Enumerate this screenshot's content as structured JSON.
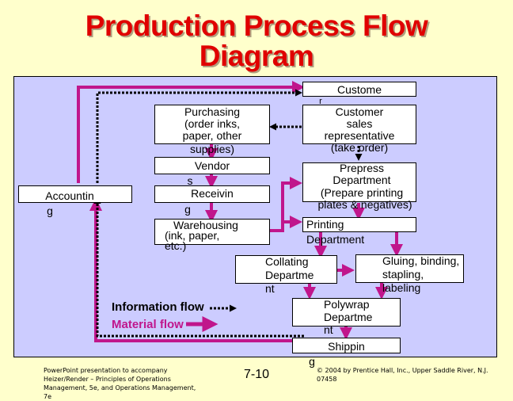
{
  "title": {
    "line1": "Production Process Flow",
    "line2": "Diagram"
  },
  "nodes": {
    "customer": [
      "Custome",
      "r"
    ],
    "customer_sales": [
      "Customer",
      "sales",
      "representative",
      "(take order)"
    ],
    "purchasing": [
      "Purchasing",
      "(order inks,",
      "paper, other",
      "supplies)"
    ],
    "vendors": [
      "Vendor",
      "s"
    ],
    "receiving": [
      "Receivin",
      "g"
    ],
    "accounting": [
      "Accountin",
      "g"
    ],
    "warehousing": [
      "Warehousing",
      "(ink, paper,",
      "etc.)"
    ],
    "prepress": [
      "Prepress",
      "Department",
      "(Prepare printing",
      "plates  & negatives)"
    ],
    "printing": [
      "Printing",
      "Department"
    ],
    "collating": [
      "Collating",
      "Departme",
      "nt"
    ],
    "gluing": [
      "Gluing, binding,",
      "stapling,",
      "labeling"
    ],
    "polywrap": [
      "Polywrap",
      "Departme",
      "nt"
    ],
    "shipping": [
      "Shippin",
      "g"
    ]
  },
  "legend": {
    "information": "Information flow",
    "material": "Material flow"
  },
  "colors": {
    "material": "#c0168c",
    "information": "#000000",
    "title": "#e00000",
    "panel": "#ccccff",
    "background": "#ffffcc"
  },
  "footer": {
    "left": [
      "PowerPoint presentation to accompany",
      "Heizer/Render – Principles of Operations",
      "Management, 5e, and Operations Management,",
      "7e"
    ],
    "center": "7-10",
    "right": [
      "© 2004 by Prentice Hall, Inc., Upper Saddle River, N.J.",
      "07458"
    ]
  }
}
